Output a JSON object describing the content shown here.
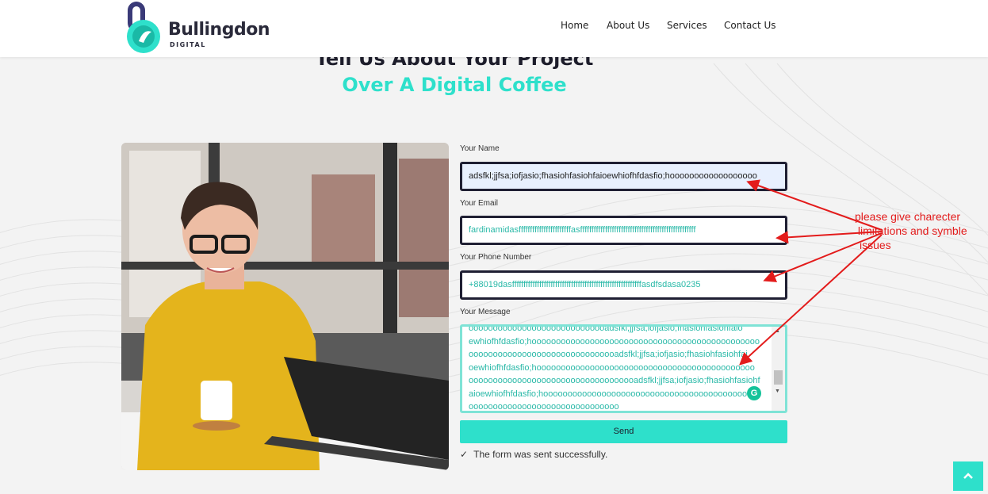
{
  "brand": {
    "name": "Bullingdon",
    "sub": "DIGITAL",
    "accent": "#2ee0cb"
  },
  "nav": {
    "items": [
      {
        "label": "Home"
      },
      {
        "label": "About Us"
      },
      {
        "label": "Services"
      },
      {
        "label": "Contact Us"
      }
    ]
  },
  "hero": {
    "line1": "Tell Us About Your Project",
    "line2": "Over A Digital Coffee"
  },
  "form": {
    "name": {
      "label": "Your Name",
      "value": "adsfkl;jjfsa;iofjasio;fhasiohfasiohfaioewhiofhfdasfio;hoooooooooooooooooo"
    },
    "email": {
      "label": "Your Email",
      "value": "fardinamidasfffffffffffffffffffffffasfffffffffffffffffffffffffffffffffffffffffffffffffff"
    },
    "phone": {
      "label": "Your Phone Number",
      "value": "+88019dasfffffffffffffffffffffffffffffffffffffffffffffffffffffffffasdfsdasa0235"
    },
    "message": {
      "label": "Your Message",
      "lines": [
        "ooooooooooooooooooooooooooooadsfkl;jjfsa;iofjasio;fhasiohfasiohfaio",
        "ewhiofhfdasfio;hooooooooooooooooooooooooooooooooooooooooooooooo",
        "ooooooooooooooooooooooooooooooadsfkl;jjfsa;iofjasio;fhasiohfasiohfai",
        "oewhiofhfdasfio;hooooooooooooooooooooooooooooooooooooooooooooo",
        "ooooooooooooooooooooooooooooooooooadsfkl;jjfsa;iofjasio;fhasiohfasiohf",
        "aioewhiofhfdasfio;hooooooooooooooooooooooooooooooooooooooooooo",
        "ooooooooooooooooooooooooooooooo"
      ]
    },
    "send_label": "Send",
    "success_text": "The form was sent successfully."
  },
  "annotation": {
    "lines": [
      "please give charecter",
      " limitations and symble",
      "issues"
    ],
    "color": "#e31b1b"
  }
}
